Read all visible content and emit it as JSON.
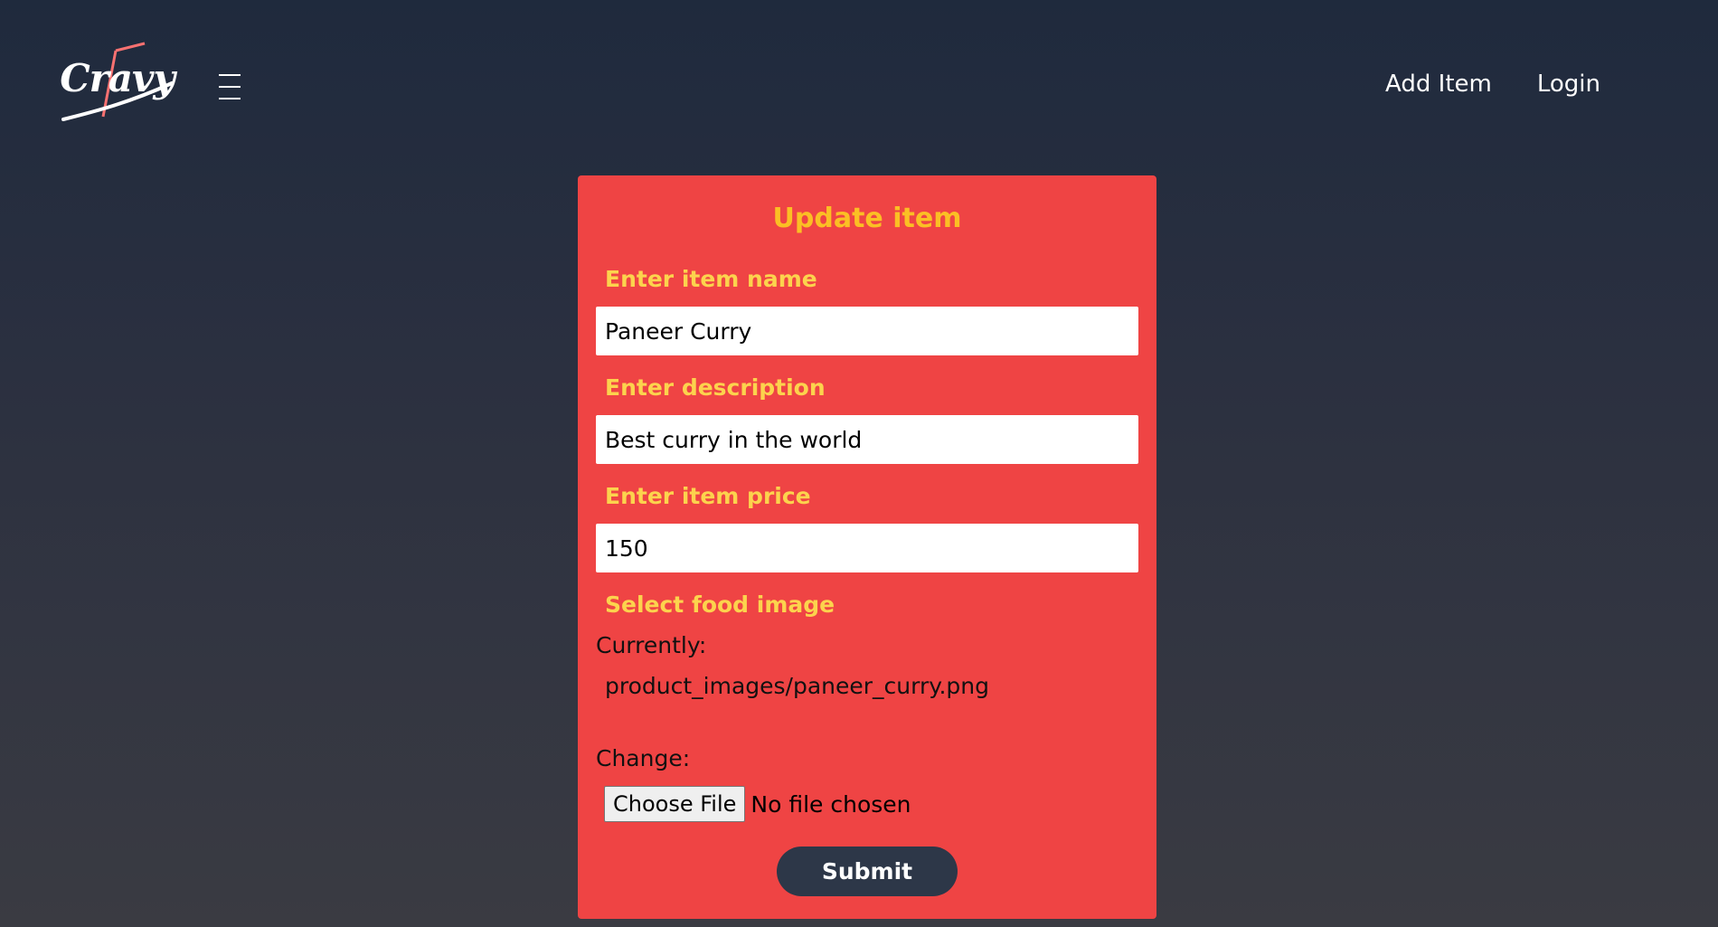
{
  "brand": {
    "logo_text": "Cravy"
  },
  "nav": {
    "items": [
      {
        "label": "Add Item"
      },
      {
        "label": "Login"
      }
    ]
  },
  "form": {
    "title": "Update item",
    "name_label": "Enter item name",
    "name_value": "Paneer Curry",
    "description_label": "Enter description",
    "description_value": "Best curry in the world",
    "price_label": "Enter item price",
    "price_value": "150",
    "image_label": "Select food image",
    "currently_label": "Currently:",
    "current_image": "product_images/paneer_curry.png",
    "change_label": "Change:",
    "choose_file_label": "Choose File",
    "file_status": "No file chosen",
    "submit_label": "Submit"
  },
  "colors": {
    "card_background": "#ef4444",
    "label_color": "#fcd34d",
    "title_color": "#fbbf24",
    "submit_background": "#2d3748"
  },
  "icons": {
    "logo": "cravy-logo-icon",
    "menu": "hamburger-menu-icon"
  }
}
